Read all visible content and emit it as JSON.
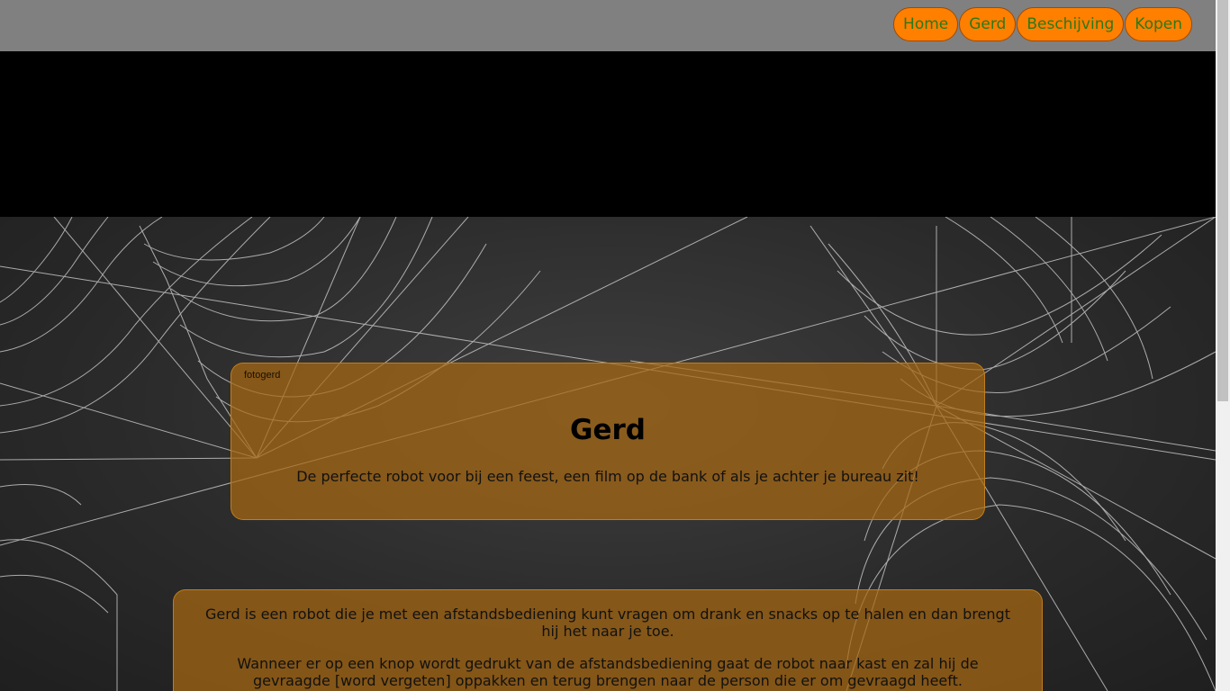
{
  "nav": {
    "items": [
      {
        "label": "Home"
      },
      {
        "label": "Gerd"
      },
      {
        "label": "Beschijving"
      },
      {
        "label": "Kopen"
      }
    ]
  },
  "hero": {
    "image_alt": "fotogerd",
    "title": "Gerd",
    "subtitle": "De perfecte robot voor bij een feest, een film op de bank of als je achter je bureau zit!"
  },
  "description": {
    "paragraph1": "Gerd is een robot die je met een afstandsbediening kunt vragen om drank en snacks op te halen en dan brengt hij het naar je toe.",
    "paragraph2": "Wanneer er op een knop wordt gedrukt van de afstandsbediening gaat de robot naar kast en zal hij de gevraagde [word vergeten] oppakken en terug brengen naar de person die er om gevraagd heeft."
  },
  "colors": {
    "header": "#808080",
    "nav_button": "#ff7f00",
    "nav_text": "#2a7a1a",
    "banner": "#000000",
    "card": "#a86812"
  }
}
